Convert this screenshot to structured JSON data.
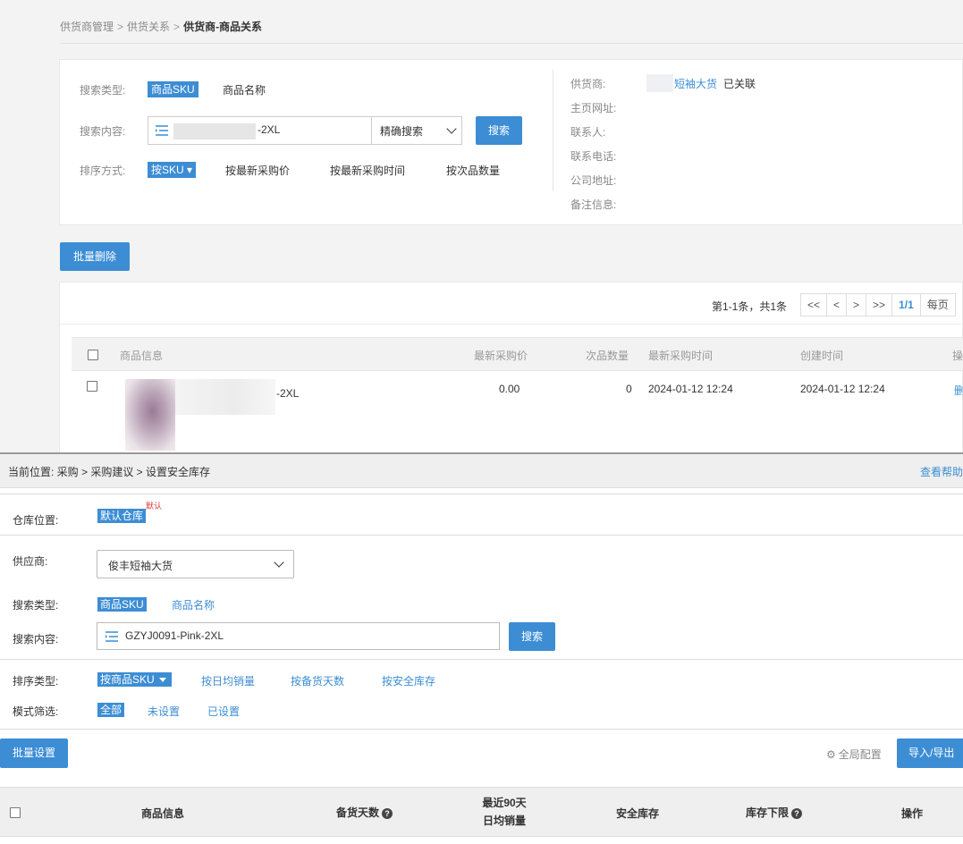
{
  "top": {
    "breadcrumb": [
      "供货商管理",
      "供货关系",
      "供货商-商品关系"
    ],
    "search_type_label": "搜索类型:",
    "search_type_active": "商品SKU",
    "search_type_other": "商品名称",
    "search_content_label": "搜索内容:",
    "search_value_suffix": "-2XL",
    "match_mode": "精确搜索",
    "search_button": "搜索",
    "sort_label": "排序方式:",
    "sort_active": "按SKU ▾",
    "sort_options": [
      "按最新采购价",
      "按最新采购时间",
      "按次品数量"
    ],
    "supplier_info": {
      "labels": [
        "供货商:",
        "主页网址:",
        "联系人:",
        "联系电话:",
        "公司地址:",
        "备注信息:"
      ],
      "supplier_name": "短袖大货",
      "supplier_status": "已关联"
    },
    "batch_delete": "批量删除",
    "pager": {
      "info": "第1-1条，共1条",
      "buttons": [
        "<<",
        "<",
        ">",
        ">>"
      ],
      "current": "1/1",
      "per_page": "每页"
    },
    "table": {
      "headers": [
        "商品信息",
        "最新采购价",
        "次品数量",
        "最新采购时间",
        "创建时间",
        "操"
      ],
      "rows": [
        {
          "sku_suffix": "-2XL",
          "price": "0.00",
          "defects": "0",
          "last_purchase": "2024-01-12 12:24",
          "created": "2024-01-12 12:24",
          "action": "删"
        }
      ]
    }
  },
  "bottom": {
    "breadcrumb": "当前位置: 采购 > 采购建议 > 设置安全库存",
    "help": "查看帮助",
    "warehouse_label": "仓库位置:",
    "warehouse_value": "默认仓库",
    "default_tag": "默认",
    "supplier_label": "供应商:",
    "supplier_value": "俊丰短袖大货",
    "search_type_label": "搜索类型:",
    "search_type_active": "商品SKU",
    "search_type_other": "商品名称",
    "search_content_label": "搜索内容:",
    "search_value": "GZYJ0091-Pink-2XL",
    "search_button": "搜索",
    "sort_label": "排序类型:",
    "sort_active": "按商品SKU",
    "sort_options": [
      "按日均销量",
      "按备货天数",
      "按安全库存"
    ],
    "mode_label": "模式筛选:",
    "mode_active": "全部",
    "mode_options": [
      "未设置",
      "已设置"
    ],
    "batch_set": "批量设置",
    "global_config": "全局配置",
    "import_export": "导入/导出",
    "table_headers": {
      "product_info": "商品信息",
      "stock_days": "备货天数",
      "sales_line1": "最近90天",
      "sales_line2": "日均销量",
      "safety_stock": "安全库存",
      "stock_floor": "库存下限",
      "action": "操作"
    }
  },
  "colors": {
    "accent": "#3c8dd4",
    "tag_red": "#e03c3c"
  }
}
